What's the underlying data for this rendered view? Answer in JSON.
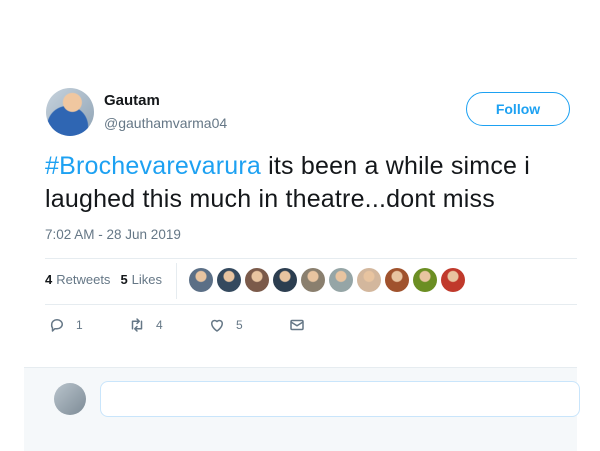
{
  "tweet": {
    "author": {
      "name": "Gautam",
      "handle": "@gauthamvarma04"
    },
    "follow_label": "Follow",
    "hashtag": "#Brochevarevarura",
    "text": " its been a while simce i laughed this much in theatre...dont miss",
    "timestamp": "7:02 AM - 28 Jun 2019"
  },
  "stats": {
    "retweets_count": "4",
    "retweets_label": "Retweets",
    "likes_count": "5",
    "likes_label": "Likes"
  },
  "likers": [
    {
      "icon": "liker-avatar",
      "color": "#5b6f86"
    },
    {
      "icon": "liker-avatar",
      "color": "#34495e"
    },
    {
      "icon": "liker-avatar",
      "color": "#7b5a4a"
    },
    {
      "icon": "liker-avatar",
      "color": "#2c3e50"
    },
    {
      "icon": "liker-avatar",
      "color": "#8a7f6e"
    },
    {
      "icon": "liker-avatar",
      "color": "#95a5a6"
    },
    {
      "icon": "liker-avatar",
      "color": "#d3b79d"
    },
    {
      "icon": "liker-avatar",
      "color": "#a0522d"
    },
    {
      "icon": "liker-avatar",
      "color": "#6b8e23"
    },
    {
      "icon": "liker-avatar",
      "color": "#c0392b"
    }
  ],
  "actions": {
    "reply_count": "1",
    "retweet_count": "4",
    "like_count": "5"
  },
  "colors": {
    "accent": "#1da1f2",
    "muted": "#657786",
    "text": "#14171a"
  }
}
